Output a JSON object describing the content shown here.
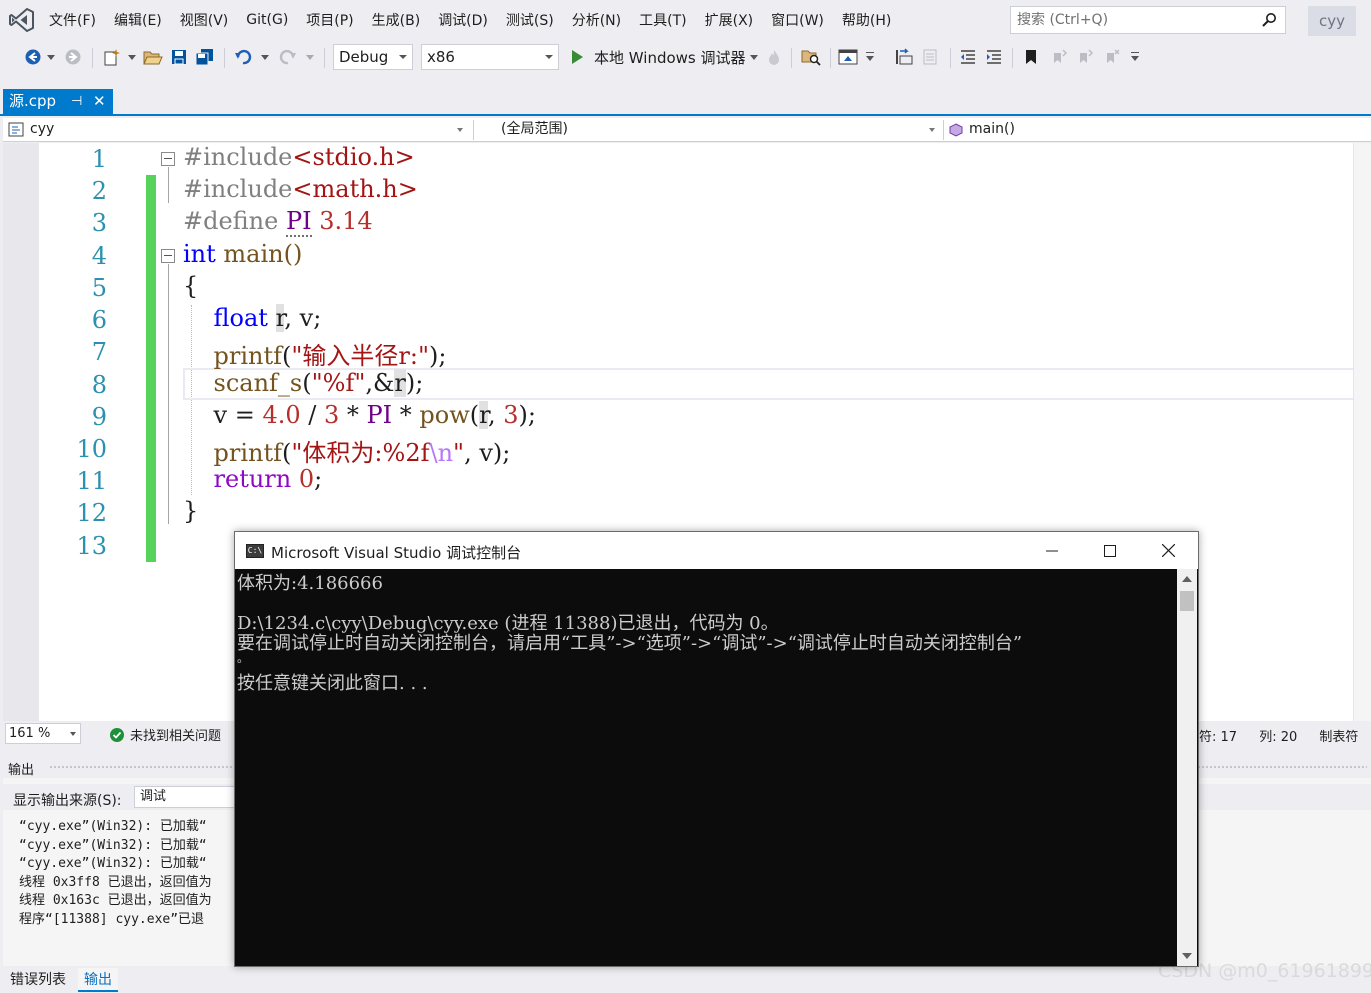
{
  "menubar": {
    "items": [
      "文件(F)",
      "编辑(E)",
      "视图(V)",
      "Git(G)",
      "项目(P)",
      "生成(B)",
      "调试(D)",
      "测试(S)",
      "分析(N)",
      "工具(T)",
      "扩展(X)",
      "窗口(W)",
      "帮助(H)"
    ],
    "search_placeholder": "搜索 (Ctrl+Q)",
    "user": "cyy"
  },
  "toolbar": {
    "configuration": "Debug",
    "platform": "x86",
    "debugger": "本地 Windows 调试器"
  },
  "tabs": [
    {
      "label": "源.cpp",
      "active": true
    }
  ],
  "navbar": {
    "project": "cyy",
    "scope": "(全局范围)",
    "member": "main()"
  },
  "editor": {
    "line_numbers": [
      "1",
      "2",
      "3",
      "4",
      "5",
      "6",
      "7",
      "8",
      "9",
      "10",
      "11",
      "12",
      "13"
    ],
    "code": {
      "l1": {
        "directive": "#include",
        "header": "<stdio.h>"
      },
      "l2": {
        "directive": "#include",
        "header": "<math.h>"
      },
      "l3": {
        "directive": "#define",
        "macro": "PI",
        "value": "3.14"
      },
      "l4": {
        "type": "int",
        "name": "main()"
      },
      "l5": "{",
      "l6": {
        "type": "float",
        "var_r": "r",
        "rest": ", v;"
      },
      "l7": {
        "fn": "printf",
        "open": "(",
        "str": "\"输入半径r:\"",
        "close": ");"
      },
      "l8": {
        "fn": "scanf_s",
        "open": "(",
        "str": "\"%f\"",
        "mid": ",&",
        "var_r": "r",
        "close": ");"
      },
      "l9": {
        "lhs": "v = ",
        "n1": "4.0",
        "op1": " / ",
        "n2": "3",
        "op2": " * ",
        "macro": "PI",
        "op3": " * ",
        "fn": "pow",
        "open": "(",
        "var_r": "r",
        "comma": ", ",
        "n3": "3",
        "close": ");"
      },
      "l10": {
        "fn": "printf",
        "open": "(",
        "str1": "\"体积为:%2f",
        "esc": "\\n",
        "str2": "\"",
        "close": ", v);"
      },
      "l11": {
        "kw": "return",
        "n": "0",
        "end": ";"
      },
      "l12": "}"
    }
  },
  "status": {
    "zoom": "161 %",
    "issues": "未找到相关问题",
    "char_label": "符: 17",
    "col_label": "列: 20",
    "tab_label": "制表符"
  },
  "output": {
    "title": "输出",
    "source_label": "显示输出来源(S):",
    "source_value": "调试",
    "lines": [
      "“cyy.exe”(Win32): 已加载“",
      "“cyy.exe”(Win32): 已加载“",
      "“cyy.exe”(Win32): 已加载“",
      "线程 0x3ff8 已退出，返回值为",
      "线程 0x163c 已退出，返回值为",
      "程序“[11388] cyy.exe”已退"
    ]
  },
  "bottom_tabs": [
    "错误列表",
    "输出"
  ],
  "console": {
    "title": "Microsoft Visual Studio 调试控制台",
    "lines": [
      "体积为:4.186666",
      "",
      "D:\\1234.c\\cyy\\Debug\\cyy.exe (进程 11388)已退出，代码为 0。",
      "要在调试停止时自动关闭控制台，请启用“工具”->“选项”->“调试”->“调试停止时自动关闭控制台”",
      "。",
      "按任意键关闭此窗口. . ."
    ]
  },
  "watermark": "CSDN @m0_61961899",
  "colors": {
    "accent": "#007acc",
    "keyword": "#0000ff",
    "string": "#a31515",
    "macro": "#6f008a",
    "preprocessor": "#808080",
    "line_number": "#2b91af",
    "change_bar": "#57d25a"
  }
}
